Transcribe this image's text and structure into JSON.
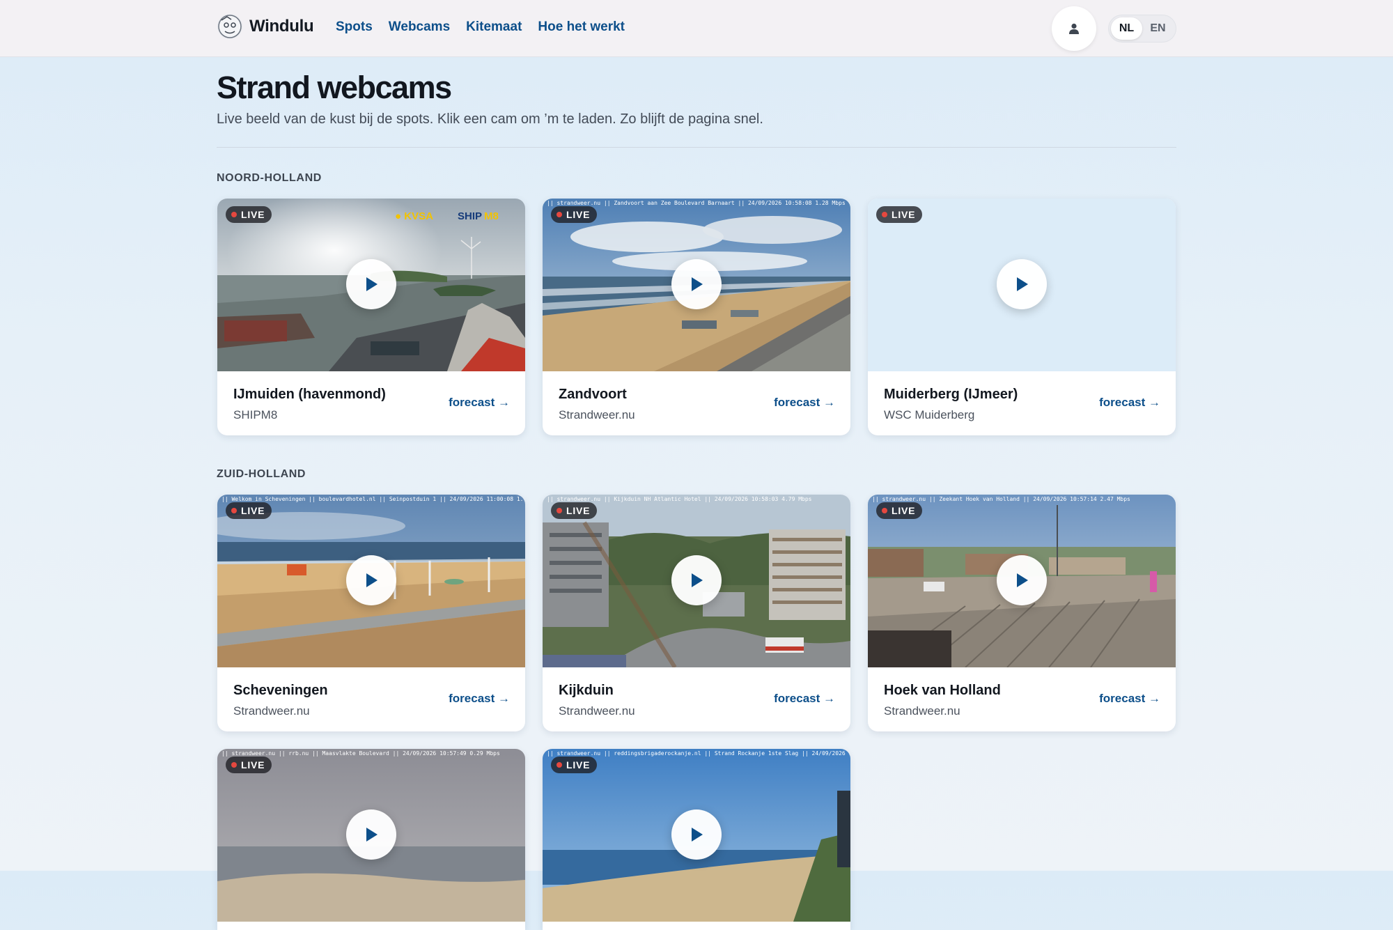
{
  "header": {
    "brand": "Windulu",
    "nav": [
      "Spots",
      "Webcams",
      "Kitemaat",
      "Hoe het werkt"
    ],
    "languages": [
      "NL",
      "EN"
    ],
    "active_language": "NL"
  },
  "page": {
    "title": "Strand webcams",
    "subtitle": "Live beeld van de kust bij de spots. Klik een cam om ’m te laden. Zo blijft de pagina snel."
  },
  "live_label": "LIVE",
  "forecast_label": "forecast →",
  "regions": [
    {
      "name": "NOORD-HOLLAND",
      "cams": [
        {
          "name": "IJmuiden (havenmond)",
          "source": "SHIPM8",
          "overlay_text": "KVSA SHIPM8"
        },
        {
          "name": "Zandvoort",
          "source": "Strandweer.nu"
        },
        {
          "name": "Muiderberg (IJmeer)",
          "source": "WSC Muiderberg"
        }
      ]
    },
    {
      "name": "ZUID-HOLLAND",
      "cams": [
        {
          "name": "Scheveningen",
          "source": "Strandweer.nu"
        },
        {
          "name": "Kijkduin",
          "source": "Strandweer.nu"
        },
        {
          "name": "Hoek van Holland",
          "source": "Strandweer.nu"
        },
        {
          "name": "",
          "source": ""
        },
        {
          "name": "",
          "source": ""
        }
      ]
    }
  ],
  "colors": {
    "accent": "#0d4f8a",
    "live_dot": "#e5483f",
    "background": "#dcebf7"
  }
}
